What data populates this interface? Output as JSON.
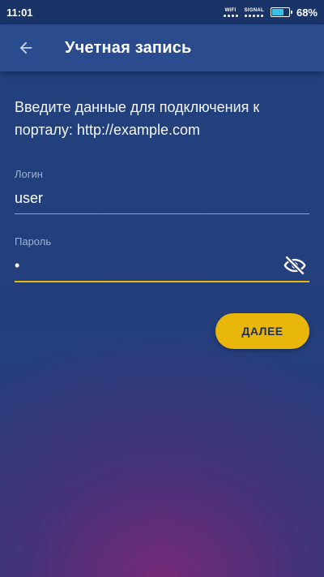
{
  "status_bar": {
    "time": "11:01",
    "wifi_label": "WIFI",
    "signal_label": "SIGNAL",
    "battery_percent_text": "68%",
    "battery_level": 0.68,
    "battery_color": "#37c3e6"
  },
  "app_bar": {
    "title": "Учетная запись",
    "back_icon": "arrow-left-icon"
  },
  "intro_text": "Введите данные для подключения к порталу: http://example.com",
  "login_field": {
    "label": "Логин",
    "value": "user"
  },
  "password_field": {
    "label": "Пароль",
    "value": "•",
    "toggle_icon": "eye-off-icon"
  },
  "next_button": {
    "label": "ДАЛЕЕ"
  },
  "colors": {
    "accent": "#e9b60b",
    "background": "#22407a",
    "app_bar": "#2a4c8e"
  }
}
